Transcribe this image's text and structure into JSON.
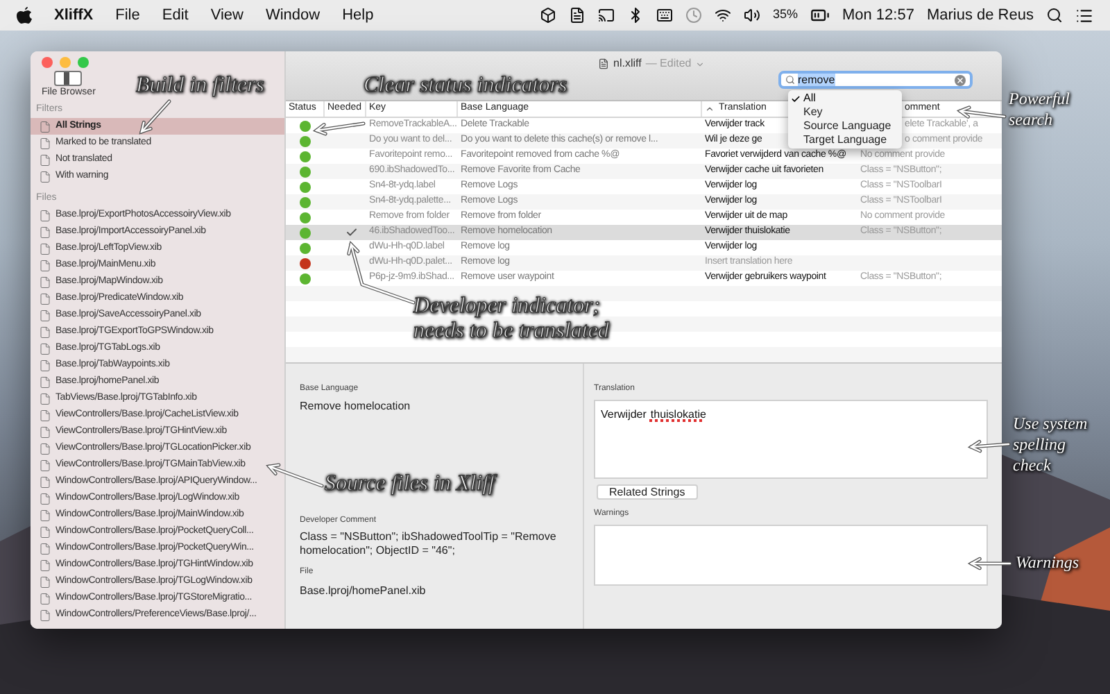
{
  "menu_bar": {
    "app_name": "XliffX",
    "items": [
      "File",
      "Edit",
      "View",
      "Window",
      "Help"
    ],
    "battery": "35%",
    "clock": "Mon 12:57",
    "user": "Marius de Reus"
  },
  "window": {
    "title": "nl.xliff",
    "title_status": "— Edited",
    "sidebar_toggle_label": "File Browser"
  },
  "search": {
    "value": "remove",
    "options": [
      {
        "label": "All",
        "selected": true
      },
      {
        "label": "Key",
        "selected": false
      },
      {
        "label": "Source Language",
        "selected": false
      },
      {
        "label": "Target Language",
        "selected": false
      }
    ]
  },
  "sidebar": {
    "filters_heading": "Filters",
    "filters": [
      {
        "label": "All Strings",
        "selected": true
      },
      {
        "label": "Marked to be translated",
        "selected": false
      },
      {
        "label": "Not translated",
        "selected": false
      },
      {
        "label": "With warning",
        "selected": false
      }
    ],
    "files_heading": "Files",
    "files": [
      {
        "label": "Base.lproj/ExportPhotosAccessoiryView.xib",
        "selected": false
      },
      {
        "label": "Base.lproj/ImportAccessoiryPanel.xib",
        "selected": false
      },
      {
        "label": "Base.lproj/LeftTopView.xib",
        "selected": false
      },
      {
        "label": "Base.lproj/MainMenu.xib",
        "selected": false
      },
      {
        "label": "Base.lproj/MapWindow.xib",
        "selected": false
      },
      {
        "label": "Base.lproj/PredicateWindow.xib",
        "selected": false
      },
      {
        "label": "Base.lproj/SaveAccessoiryPanel.xib",
        "selected": false
      },
      {
        "label": "Base.lproj/TGExportToGPSWindow.xib",
        "selected": false
      },
      {
        "label": "Base.lproj/TGTabLogs.xib",
        "selected": false
      },
      {
        "label": "Base.lproj/TabWaypoints.xib",
        "selected": false
      },
      {
        "label": "Base.lproj/homePanel.xib",
        "selected": false
      },
      {
        "label": "TabViews/Base.lproj/TGTabInfo.xib",
        "selected": false
      },
      {
        "label": "ViewControllers/Base.lproj/CacheListView.xib",
        "selected": false
      },
      {
        "label": "ViewControllers/Base.lproj/TGHintView.xib",
        "selected": false
      },
      {
        "label": "ViewControllers/Base.lproj/TGLocationPicker.xib",
        "selected": false
      },
      {
        "label": "ViewControllers/Base.lproj/TGMainTabView.xib",
        "selected": false
      },
      {
        "label": "WindowControllers/Base.lproj/APIQueryWindow...",
        "selected": false
      },
      {
        "label": "WindowControllers/Base.lproj/LogWindow.xib",
        "selected": false
      },
      {
        "label": "WindowControllers/Base.lproj/MainWindow.xib",
        "selected": false
      },
      {
        "label": "WindowControllers/Base.lproj/PocketQueryColl...",
        "selected": false
      },
      {
        "label": "WindowControllers/Base.lproj/PocketQueryWin...",
        "selected": false
      },
      {
        "label": "WindowControllers/Base.lproj/TGHintWindow.xib",
        "selected": false
      },
      {
        "label": "WindowControllers/Base.lproj/TGLogWindow.xib",
        "selected": false
      },
      {
        "label": "WindowControllers/Base.lproj/TGStoreMigratio...",
        "selected": false
      },
      {
        "label": "WindowControllers/PreferenceViews/Base.lproj/...",
        "selected": false
      }
    ]
  },
  "table": {
    "columns": [
      {
        "label": "Status",
        "sorted": false
      },
      {
        "label": "Needed",
        "sorted": false
      },
      {
        "label": "Key",
        "sorted": false
      },
      {
        "label": "Base Language",
        "sorted": false
      },
      {
        "label": "Translation",
        "sorted": true
      },
      {
        "label": "omment",
        "sorted": false
      }
    ],
    "rows": [
      {
        "color": "#5cb531",
        "needed": false,
        "selected": false,
        "key": "RemoveTrackableA...",
        "base": "Delete Trackable",
        "translation": "Verwijder track",
        "comment": "elete Trackable', a"
      },
      {
        "color": "#5cb531",
        "needed": false,
        "selected": false,
        "key": "Do you want to del...",
        "base": "Do you want to delete this cache(s) or remove l...",
        "translation": "Wil je deze ge",
        "comment": "o comment provide"
      },
      {
        "color": "#5cb531",
        "needed": false,
        "selected": false,
        "key": "Favoritepoint remo...",
        "base": "Favoritepoint removed from cache %@",
        "translation": "Favoriet verwijderd van cache %@",
        "comment": "No comment provide"
      },
      {
        "color": "#5cb531",
        "needed": false,
        "selected": false,
        "key": "690.ibShadowedTo...",
        "base": "Remove Favorite from Cache",
        "translation": "Verwijder cache uit favorieten",
        "comment": "Class = \"NSButton\";"
      },
      {
        "color": "#5cb531",
        "needed": false,
        "selected": false,
        "key": "Sn4-8t-ydq.label",
        "base": "Remove Logs",
        "translation": "Verwijder log",
        "comment": "Class = \"NSToolbarI"
      },
      {
        "color": "#5cb531",
        "needed": false,
        "selected": false,
        "key": "Sn4-8t-ydq.palette...",
        "base": "Remove Logs",
        "translation": "Verwijder log",
        "comment": "Class = \"NSToolbarI"
      },
      {
        "color": "#5cb531",
        "needed": false,
        "selected": false,
        "key": "Remove from folder",
        "base": "Remove from folder",
        "translation": "Verwijder uit de map",
        "comment": "No comment provide"
      },
      {
        "color": "#5cb531",
        "needed": true,
        "selected": true,
        "key": "46.ibShadowedToo...",
        "base": "Remove homelocation",
        "translation": "Verwijder thuislokatie",
        "comment": "Class = \"NSButton\";"
      },
      {
        "color": "#5cb531",
        "needed": false,
        "selected": false,
        "key": "dWu-Hh-q0D.label",
        "base": "Remove log",
        "translation": "Verwijder log"
      },
      {
        "color": "#c4331c",
        "needed": false,
        "selected": false,
        "key": "dWu-Hh-q0D.palet...",
        "base": "Remove log",
        "translation_placeholder": "Insert translation here"
      },
      {
        "color": "#5cb531",
        "needed": false,
        "selected": false,
        "key": "P6p-jz-9m9.ibShad...",
        "base": "Remove user waypoint",
        "translation": "Verwijder gebruikers waypoint",
        "comment": "Class = \"NSButton\";"
      }
    ]
  },
  "detail": {
    "base_label": "Base Language",
    "base_value": "Remove homelocation",
    "comment_label": "Developer Comment",
    "comment_value": "Class = \"NSButton\"; ibShadowedToolTip = \"Remove homelocation\"; ObjectID = \"46\";",
    "file_label": "File",
    "file_value": "Base.lproj/homePanel.xib",
    "translation_label": "Translation",
    "translation_words": [
      {
        "text": "Verwijder",
        "misspelled": false
      },
      {
        "text": "thuislokatie",
        "misspelled": true
      }
    ],
    "related_button": "Related Strings",
    "warnings_label": "Warnings"
  },
  "annotations": [
    {
      "text": "Build in filters"
    },
    {
      "text": "Clear status indicators"
    },
    {
      "text": "Powerful search"
    },
    {
      "text": "Developer indicator; needs to be translated"
    },
    {
      "text": "Use system spelling check"
    },
    {
      "text": "Source files in Xliff"
    },
    {
      "text": "Warnings"
    }
  ]
}
